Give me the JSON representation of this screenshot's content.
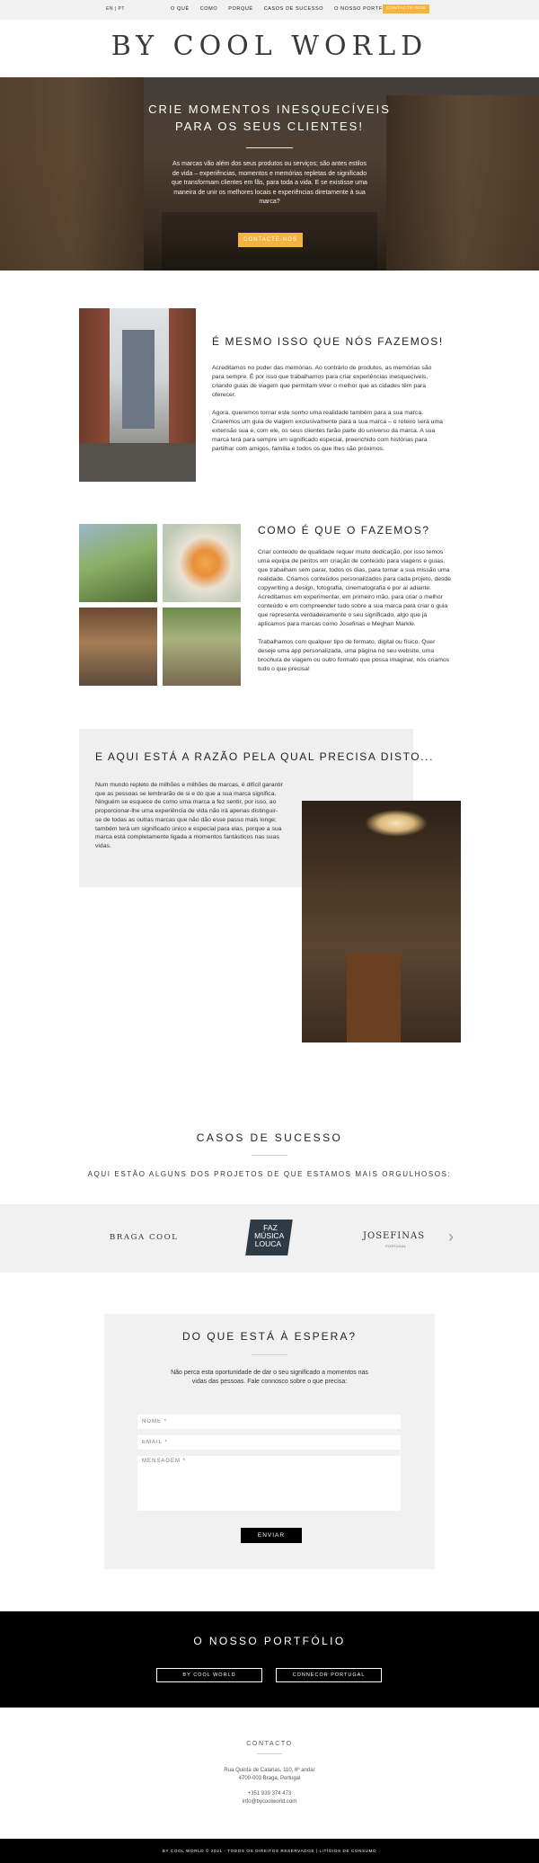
{
  "nav": {
    "lang": "EN | PT",
    "items": [
      "O QUÊ",
      "COMO",
      "PORQUÊ",
      "CASOS DE SUCESSO",
      "O NOSSO PORTFOLIO"
    ],
    "cta": "CONTACTE-NOS"
  },
  "brand": {
    "logo": "BY COOL WORLD"
  },
  "hero": {
    "title_line1": "CRIE MOMENTOS INESQUECÍVEIS",
    "title_line2": "PARA OS SEUS CLIENTES!",
    "text": "As marcas vão além dos seus produtos ou serviços; são antes estilos de vida – experiências, momentos e memórias repletas de significado que transformam clientes em fãs, para toda a vida. E se existisse uma maneira de unir os melhores locais e experiências diretamente à sua marca?",
    "button": "CONTACTE-NOS"
  },
  "what": {
    "title": "É MESMO ISSO QUE NÓS FAZEMOS!",
    "p1": "Acreditamos no poder das memórias. Ao contrário de produtos, as memórias são para sempre. É por isso que trabalhamos para criar experiências inesquecíveis, criando guias de viagem que permitam viver o melhor que as cidades têm para oferecer.",
    "p2": "Agora, queremos tornar este sonho uma realidade também para a sua marca. Criaremos um guia de viagem exclusivamente para a sua marca – o roteiro será uma extensão sua e, com ele, os seus clientes farão parte do universo da marca. A sua marca terá para sempre um significado especial, preenchido com histórias para partilhar com amigos, família e todos os que lhes são próximos."
  },
  "how": {
    "title": "COMO É QUE O FAZEMOS?",
    "p1": "Criar conteúdo de qualidade requer muito dedicação, por isso temos uma equipa de peritos em criação de conteúdo para viagens e guias, que trabalham sem parar, todos os dias, para tornar a sua missão uma realidade. Criamos conteúdos personalizados para cada projeto, desde copywriting a design, fotografia, cinematografia e por aí adiante. Acreditamos em experimentar, em primeiro mão, para criar o melhor conteúdo e em compreender tudo sobre a sua marca para criar o guia que representa verdadeiramente o seu significado, algo que já aplicamos para marcas como Josefinas e Meghan Markle.",
    "p2": "Trabalhamos com qualquer tipo de formato, digital ou físico. Quer deseje uma app personalizada, uma página no seu website, uma brochura de viagem ou outro formato que possa imaginar, nós criamos tudo o que precisa!"
  },
  "why": {
    "title": "E AQUI ESTÁ A RAZÃO PELA QUAL PRECISA DISTO...",
    "text": "Num mundo repleto de milhões e milhões de marcas, é difícil garantir que as pessoas se lembrarão de si e do que a sua marca significa. Ninguém se esquece de como uma marca a fez sentir, por isso, ao proporcionar-lhe uma experiência de vida não irá apenas distinguir-se de todas as outras marcas que não dão esse passo mais longe; também terá um significado único e especial para elas, porque a sua marca está completamente ligada a momentos fantásticos nas suas vidas."
  },
  "cases": {
    "title": "CASOS DE SUCESSO",
    "subtitle": "AQUI ESTÃO ALGUNS DOS PROJETOS DE QUE ESTAMOS MAIS ORGULHOSOS:",
    "logos": {
      "braga": "BRAGA COOL",
      "faz_1": "FAZ",
      "faz_2": "MÚSICA",
      "faz_3": "LOUCA",
      "josefinas": "JOSEFINAS",
      "josefinas_sub": "PORTUGAL"
    },
    "next_arrow": "›"
  },
  "form": {
    "title": "DO QUE ESTÁ À ESPERA?",
    "subtitle": "Não perca esta oportunidade de dar o seu significado a momentos nas vidas das pessoas. Fale connosco sobre o que precisa:",
    "name_placeholder": "NOME *",
    "email_placeholder": "EMAIL *",
    "message_placeholder": "MENSAGEM *",
    "submit": "ENVIAR"
  },
  "portfolio": {
    "title": "O NOSSO PORTFÓLIO",
    "btn1": "BY COOL WORLD",
    "btn2": "CONNECOR PORTUGAL"
  },
  "contact": {
    "title": "CONTACTO",
    "address1": "Rua Quinta de Calarias, 110, 6º andar",
    "address2": "4700-003 Braga, Portugal",
    "phone": "+351 939 374 473",
    "email": "info@bycoolworld.com"
  },
  "footer": {
    "text": "BY COOL WORLD © 2021 - TODOS OS DIREITOS RESERVADOS | LITÍGIOS DE CONSUMO"
  }
}
